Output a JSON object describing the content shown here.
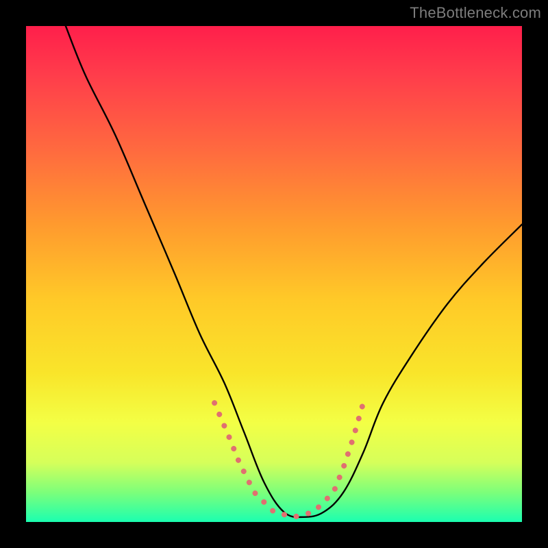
{
  "watermark": "TheBottleneck.com",
  "chart_data": {
    "type": "line",
    "title": "",
    "xlabel": "",
    "ylabel": "",
    "xlim": [
      0,
      100
    ],
    "ylim": [
      0,
      100
    ],
    "grid": false,
    "legend": false,
    "colors": {
      "curve": "#000000",
      "dots": "#e07070",
      "gradient_top": "#ff1f4b",
      "gradient_bottom": "#1bffb0"
    },
    "series": [
      {
        "name": "curve",
        "x": [
          8,
          12,
          18,
          24,
          30,
          35,
          40,
          44,
          48,
          52,
          56,
          60,
          64,
          68,
          72,
          78,
          85,
          92,
          100
        ],
        "values": [
          100,
          90,
          78,
          64,
          50,
          38,
          28,
          18,
          8,
          2,
          1,
          2,
          6,
          14,
          24,
          34,
          44,
          52,
          60
        ]
      },
      {
        "name": "dots",
        "x": [
          38,
          41,
          43,
          46,
          50,
          54,
          58,
          62,
          64,
          66,
          68
        ],
        "values": [
          24,
          17,
          12,
          6,
          2,
          1,
          2,
          6,
          11,
          17,
          24
        ]
      }
    ]
  }
}
